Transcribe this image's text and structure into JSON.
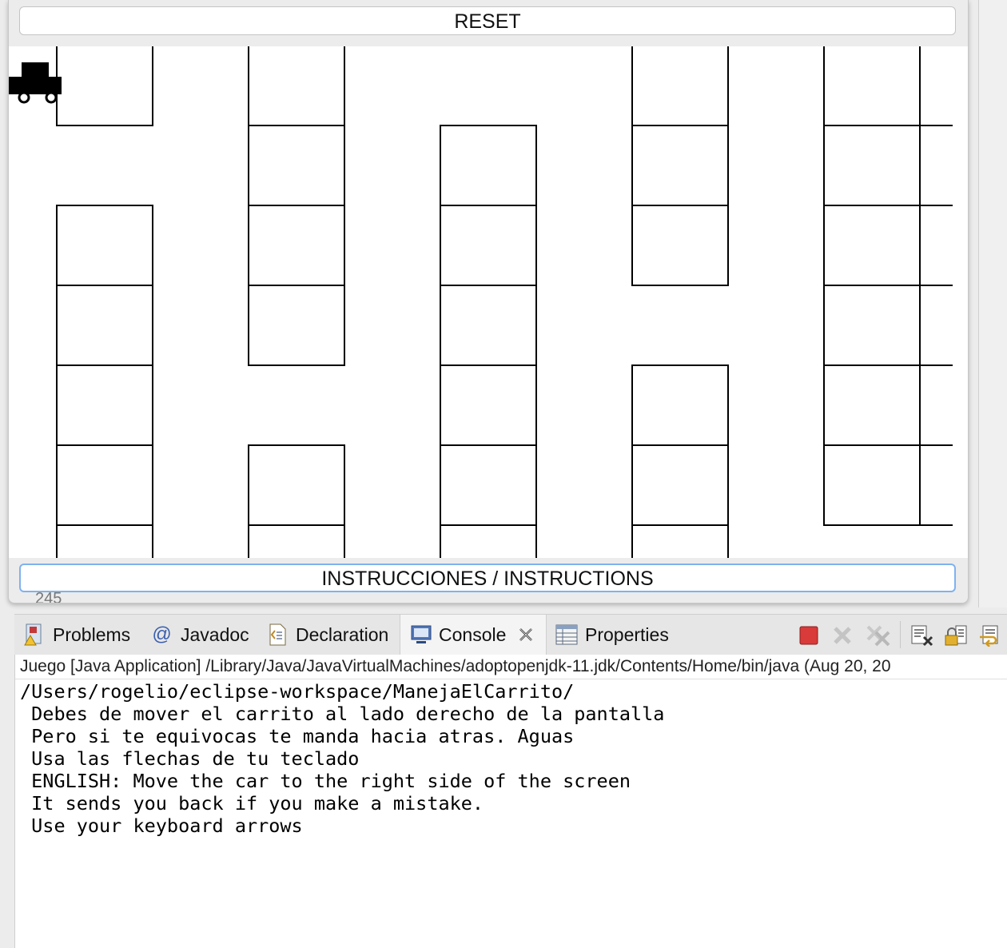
{
  "game": {
    "reset_label": "RESET",
    "instructions_label": "INSTRUCCIONES / INSTRUCTIONS"
  },
  "peek_text": "245",
  "tabs": [
    {
      "label": "Problems",
      "icon": "problems-icon"
    },
    {
      "label": "Javadoc",
      "icon": "at-sign-icon"
    },
    {
      "label": "Declaration",
      "icon": "declaration-icon"
    },
    {
      "label": "Console",
      "icon": "console-icon"
    },
    {
      "label": "Properties",
      "icon": "properties-icon"
    }
  ],
  "toolbar_icons": [
    "terminate-icon",
    "remove-launch-icon",
    "remove-all-terminated-icon",
    "clear-console-icon",
    "scroll-lock-icon",
    "word-wrap-icon"
  ],
  "console": {
    "launch_label": "Juego [Java Application] /Library/Java/JavaVirtualMachines/adoptopenjdk-11.jdk/Contents/Home/bin/java  (Aug 20, 20",
    "lines": [
      "/Users/rogelio/eclipse-workspace/ManejaElCarrito/",
      " Debes de mover el carrito al lado derecho de la pantalla",
      " Pero si te equivocas te manda hacia atras. Aguas",
      " Usa las flechas de tu teclado",
      " ENGLISH: Move the car to the right side of the screen",
      " It sends you back if you make a mistake.",
      " Use your keyboard arrows"
    ]
  },
  "colors": {
    "terminate": "#d93a3a",
    "focus_border": "#7fb2ef",
    "maze_line": "#000000"
  }
}
